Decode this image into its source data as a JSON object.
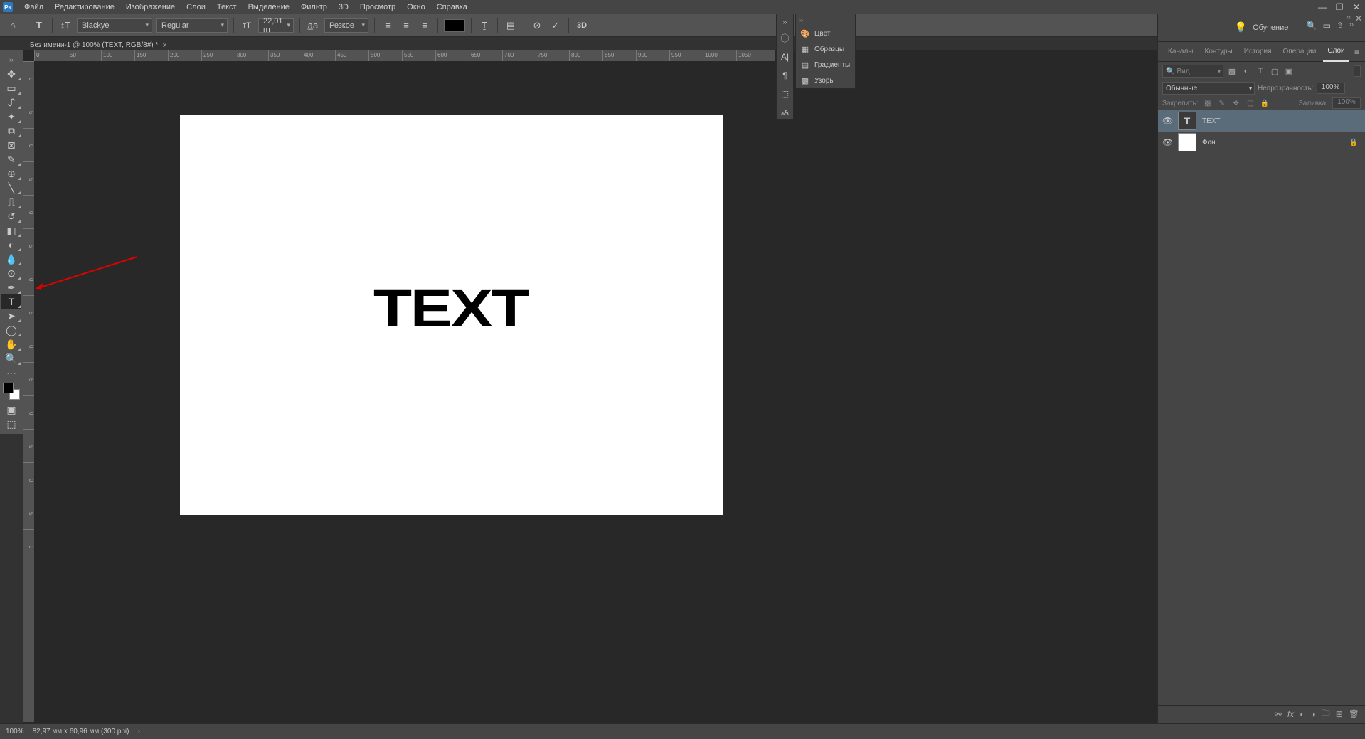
{
  "menu": {
    "items": [
      "Файл",
      "Редактирование",
      "Изображение",
      "Слои",
      "Текст",
      "Выделение",
      "Фильтр",
      "3D",
      "Просмотр",
      "Окно",
      "Справка"
    ]
  },
  "options": {
    "font_family": "Blackye",
    "font_style": "Regular",
    "font_size": "22,01 пт",
    "antialias": "Резкое"
  },
  "doc_tab": {
    "title": "Без имени-1 @ 100% (TEXT, RGB/8#) *"
  },
  "canvas": {
    "text": "TEXT"
  },
  "ruler_h": [
    "0",
    "50",
    "100",
    "150",
    "200",
    "250",
    "300",
    "350",
    "400",
    "450",
    "500",
    "550",
    "600",
    "650",
    "700",
    "750",
    "800",
    "850",
    "900",
    "950",
    "1000",
    "1050"
  ],
  "ruler_v": [
    "0",
    "5",
    "0",
    "5",
    "0",
    "5",
    "0",
    "5",
    "0",
    "5",
    "0",
    "5",
    "0",
    "5",
    "0"
  ],
  "panelA": {
    "rows": [
      {
        "icon": "🎨",
        "label": "Цвет"
      },
      {
        "icon": "▦",
        "label": "Образцы"
      },
      {
        "icon": "▤",
        "label": "Градиенты"
      },
      {
        "icon": "▩",
        "label": "Узоры"
      }
    ]
  },
  "right": {
    "learn_label": "Обучение",
    "tabs": [
      "Каналы",
      "Контуры",
      "История",
      "Операции",
      "Слои"
    ],
    "active_tab": 4,
    "filter_placeholder": "Вид",
    "blend_mode": "Обычные",
    "opacity_label": "Непрозрачность:",
    "opacity_value": "100%",
    "lock_label": "Закрепить:",
    "fill_label": "Заливка:",
    "fill_value": "100%",
    "layers": [
      {
        "name": "TEXT",
        "type": "text",
        "active": true,
        "locked": false
      },
      {
        "name": "Фон",
        "type": "bg",
        "active": false,
        "locked": true
      }
    ]
  },
  "status": {
    "zoom": "100%",
    "info": "82,97 мм x 60,96 мм (300 ppi)"
  }
}
